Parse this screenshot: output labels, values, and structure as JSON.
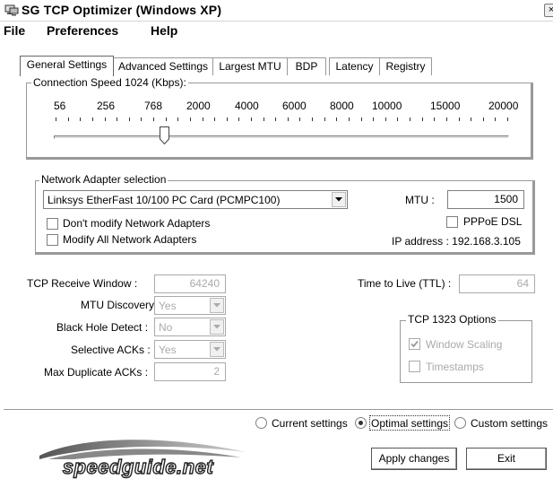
{
  "window": {
    "title": "SG TCP Optimizer (Windows XP)",
    "close_glyph": "×",
    "app_icon": "network-computer-icon"
  },
  "menu": {
    "items": [
      "File",
      "Preferences",
      "Help"
    ]
  },
  "tabs": [
    "General Settings",
    "Advanced Settings",
    "Largest MTU",
    "BDP",
    "Latency",
    "Registry"
  ],
  "active_tab": "General Settings",
  "connection_speed": {
    "label": "Connection Speed  1024 (Kbps):",
    "scale": [
      "56",
      "256",
      "768",
      "2000",
      "4000",
      "6000",
      "8000",
      "10000",
      "15000",
      "20000"
    ],
    "current_kbps": 1024
  },
  "network_adapter": {
    "legend": "Network Adapter selection",
    "selected": "Linksys EtherFast 10/100 PC Card (PCMPC100)",
    "mtu_label": "MTU :",
    "mtu_value": "1500",
    "dont_modify_label": "Don't modify Network Adapters",
    "dont_modify_checked": false,
    "modify_all_label": "Modify All Network Adapters",
    "modify_all_checked": false,
    "pppoe_label": "PPPoE DSL",
    "pppoe_checked": false,
    "ip_label": "IP address : 192.168.3.105"
  },
  "tcp": {
    "rwin_label": "TCP Receive Window :",
    "rwin_value": "64240",
    "mtu_discovery_label": "MTU Discovery :",
    "mtu_discovery_value": "Yes",
    "black_hole_label": "Black Hole Detect :",
    "black_hole_value": "No",
    "sack_label": "Selective ACKs :",
    "sack_value": "Yes",
    "max_dup_label": "Max Duplicate ACKs :",
    "max_dup_value": "2",
    "ttl_label": "Time to Live (TTL) :",
    "ttl_value": "64"
  },
  "tcp1323": {
    "legend": "TCP 1323 Options",
    "window_scaling_label": "Window Scaling",
    "window_scaling_checked": true,
    "timestamps_label": "Timestamps",
    "timestamps_checked": false
  },
  "settings_mode": {
    "options": [
      "Current settings",
      "Optimal settings",
      "Custom settings"
    ],
    "selected": "Optimal settings"
  },
  "buttons": {
    "apply": "Apply changes",
    "exit": "Exit"
  },
  "logo": {
    "text": "speedguide.net"
  }
}
